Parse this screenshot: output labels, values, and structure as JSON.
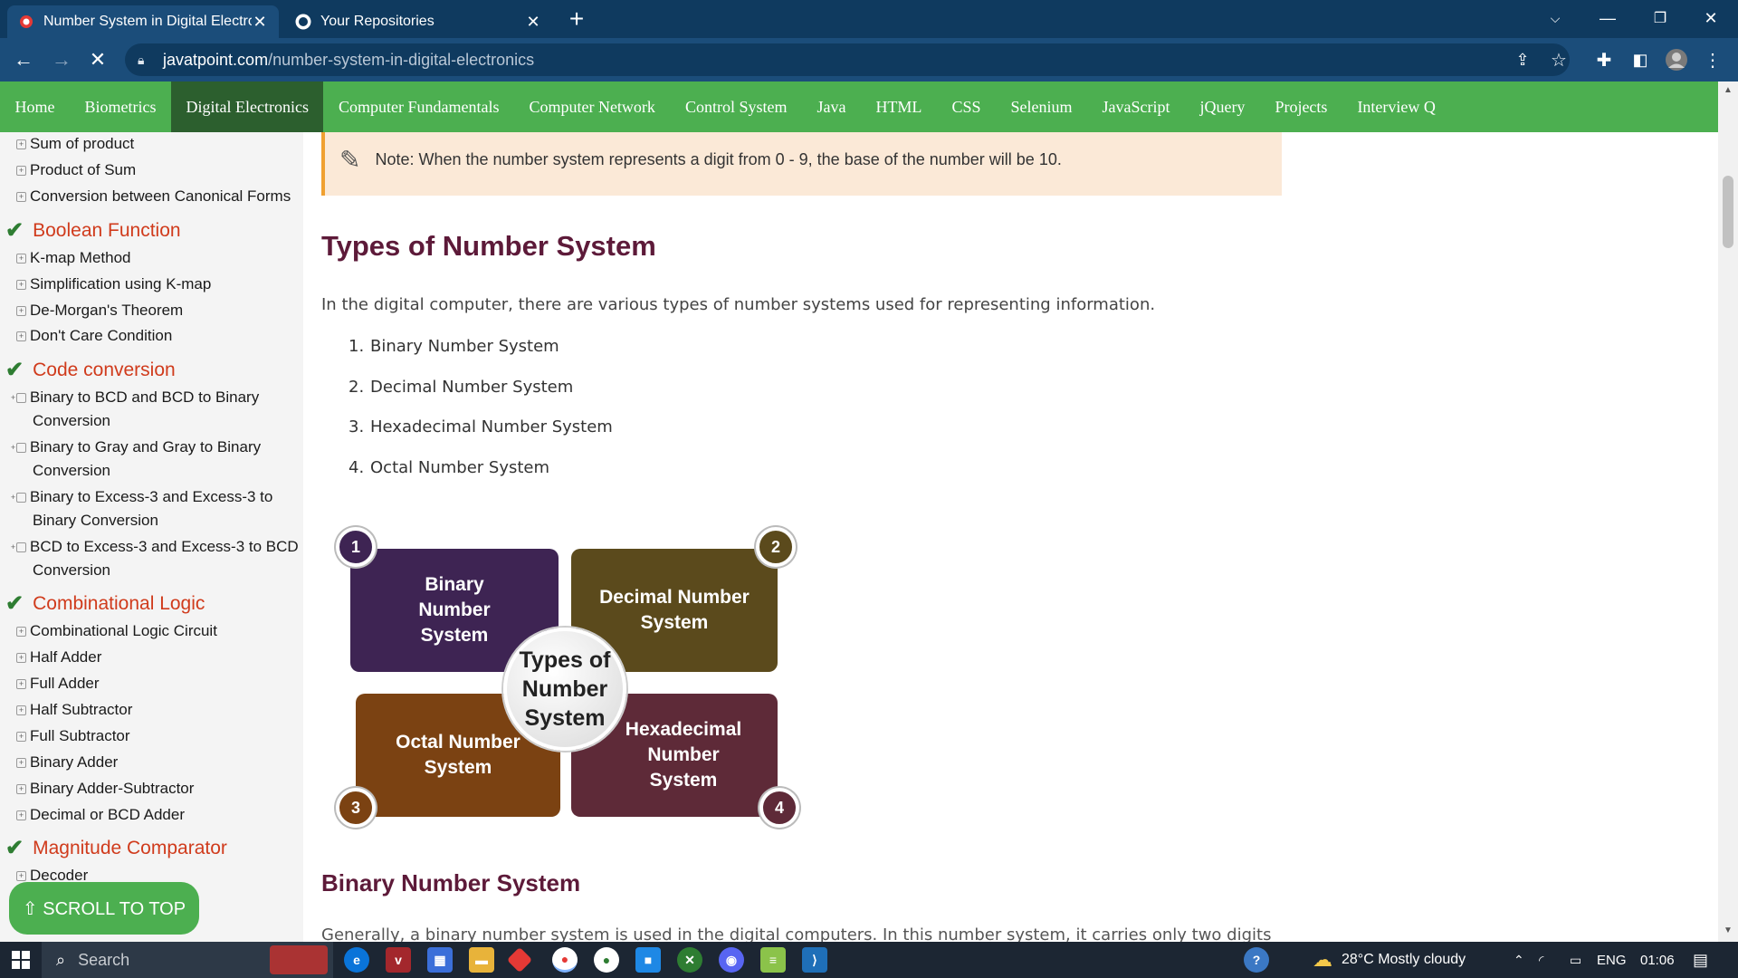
{
  "browser": {
    "tabs": [
      {
        "title": "Number System in Digital Electro",
        "active": true
      },
      {
        "title": "Your Repositories",
        "active": false
      }
    ],
    "url_domain": "javatpoint.com",
    "url_path": "/number-system-in-digital-electronics"
  },
  "nav": {
    "items": [
      "Home",
      "Biometrics",
      "Digital Electronics",
      "Computer Fundamentals",
      "Computer Network",
      "Control System",
      "Java",
      "HTML",
      "CSS",
      "Selenium",
      "JavaScript",
      "jQuery",
      "Projects",
      "Interview Q"
    ],
    "active": "Digital Electronics"
  },
  "sidebar": {
    "links_top": [
      "Sum of product",
      "Product of Sum",
      "Conversion between Canonical Forms"
    ],
    "section1": {
      "title": "Boolean Function",
      "links": [
        "K-map Method",
        "Simplification using K-map",
        "De-Morgan's Theorem",
        "Don't Care Condition"
      ]
    },
    "section2": {
      "title": "Code conversion",
      "links": [
        "Binary to BCD and BCD to Binary Conversion",
        "Binary to Gray and Gray to Binary Conversion",
        "Binary to Excess-3 and Excess-3 to Binary Conversion",
        "BCD to Excess-3 and Excess-3 to BCD Conversion"
      ]
    },
    "section3": {
      "title": "Combinational Logic",
      "links": [
        "Combinational Logic Circuit",
        "Half Adder",
        "Full Adder",
        "Half Subtractor",
        "Full Subtractor",
        "Binary Adder",
        "Binary Adder-Subtractor",
        "Decimal or BCD Adder"
      ]
    },
    "section4": {
      "title": "Magnitude Comparator",
      "links": [
        "Decoder"
      ]
    },
    "scroll_top_label": "⇧ SCROLL TO TOP"
  },
  "content": {
    "note": "Note: When the number system represents a digit from 0 - 9, the base of the number will be 10.",
    "heading": "Types of Number System",
    "intro": "In the digital computer, there are various types of number systems used for representing information.",
    "list": [
      "Binary Number System",
      "Decimal Number System",
      "Hexadecimal Number System",
      "Octal Number System"
    ],
    "diagram": {
      "center": "Types of Number System",
      "q1": "Binary Number System",
      "q2": "Decimal Number System",
      "q3": "Octal Number System",
      "q4": "Hexadecimal Number System",
      "n1": "1",
      "n2": "2",
      "n3": "3",
      "n4": "4"
    },
    "subheading": "Binary Number System",
    "cut_para": "Generally, a binary number system is used in the digital computers. In this number system, it carries only two digits"
  },
  "taskbar": {
    "search_placeholder": "Search",
    "weather": "28°C  Mostly cloudy",
    "lang": "ENG",
    "time": "01:06"
  },
  "colors": {
    "nav_green": "#4caf50",
    "nav_active": "#2c5f2e",
    "heading": "#5d1a39",
    "section_red": "#d03b1c"
  }
}
